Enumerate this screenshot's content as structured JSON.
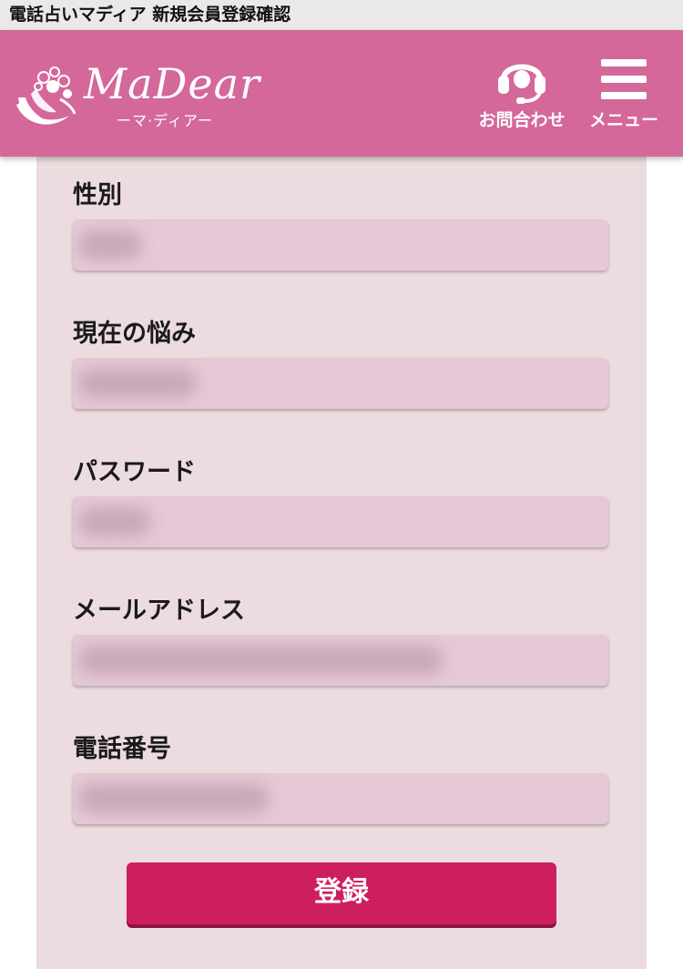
{
  "browser": {
    "page_title": "電話占いマディア 新規会員登録確認"
  },
  "header": {
    "logo_text": "MaDear",
    "logo_sub": "ーマ·ディアー",
    "contact_label": "お問合わせ",
    "menu_label": "メニュー",
    "brand_color": "#d4689a",
    "icons": [
      "headset-icon",
      "hamburger-menu-icon"
    ]
  },
  "form": {
    "fields": [
      {
        "label": "性別",
        "value": ""
      },
      {
        "label": "現在の悩み",
        "value": ""
      },
      {
        "label": "パスワード",
        "value": ""
      },
      {
        "label": "メールアドレス",
        "value": ""
      },
      {
        "label": "電話番号",
        "value": ""
      }
    ],
    "submit_label": "登録",
    "submit_color": "#cd1e5f"
  }
}
